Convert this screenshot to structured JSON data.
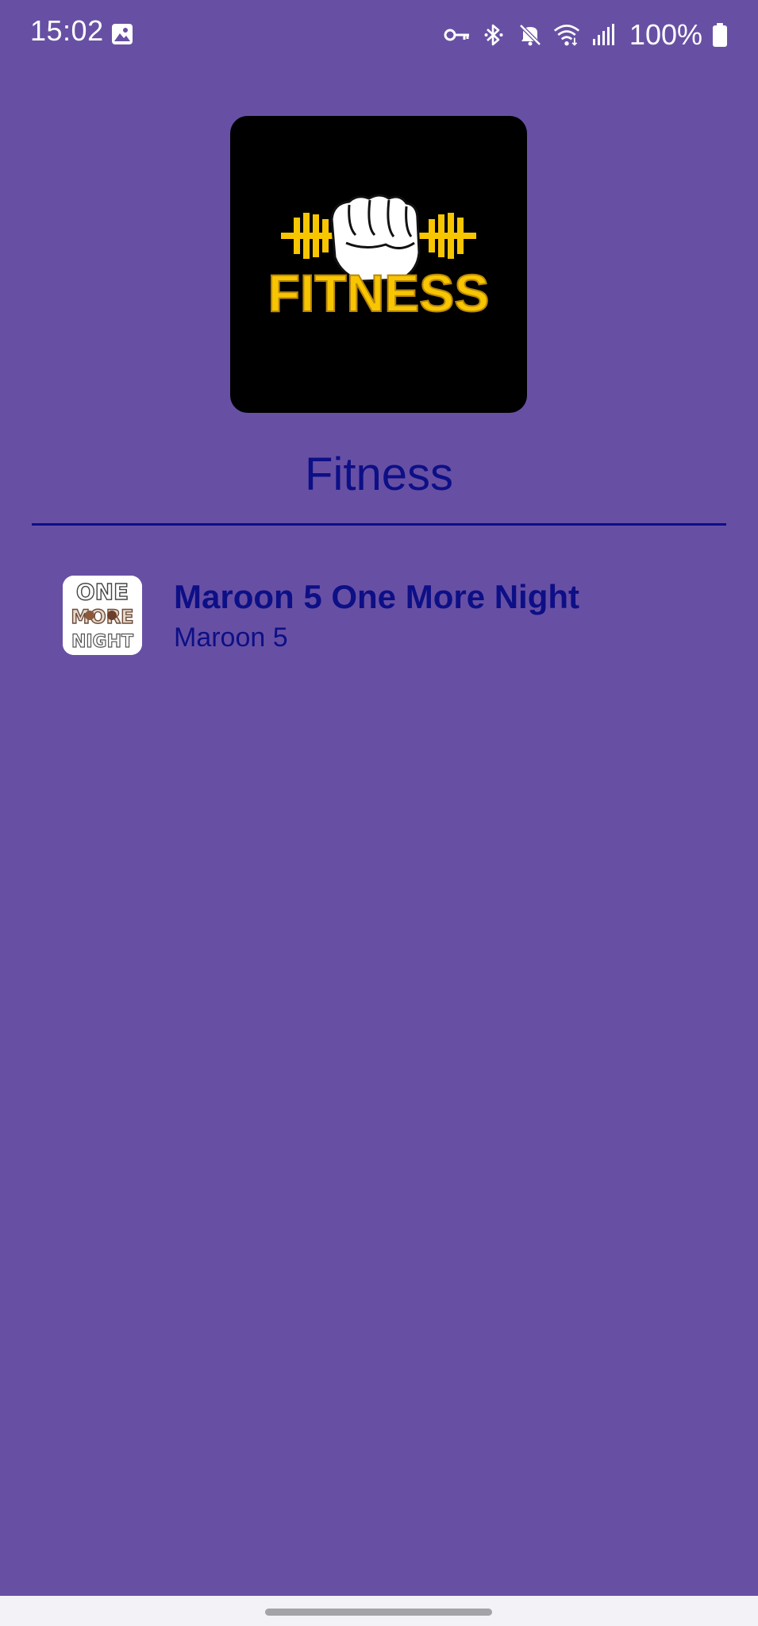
{
  "status_bar": {
    "time": "15:02",
    "battery": "100%",
    "icons": [
      "gallery-icon",
      "vpn-key-icon",
      "bluetooth-icon",
      "mute-icon",
      "wifi-icon",
      "signal-icon",
      "battery-icon"
    ]
  },
  "playlist": {
    "title": "Fitness",
    "cover_art": {
      "icon": "fitness-logo",
      "text": "FITNESS",
      "colors": {
        "background": "#000000",
        "accent": "#F7C600"
      }
    }
  },
  "tracks": [
    {
      "title": "Maroon 5 One More Night",
      "artist": "Maroon 5",
      "thumbnail": {
        "icon": "one-more-night-artwork",
        "text": [
          "ONE",
          "MORE",
          "NIGHT"
        ]
      }
    }
  ],
  "colors": {
    "background": "#6750A4",
    "text": "#0D0F86",
    "status_text": "#FFFFFF",
    "nav_bar": "#F3F2F6"
  }
}
